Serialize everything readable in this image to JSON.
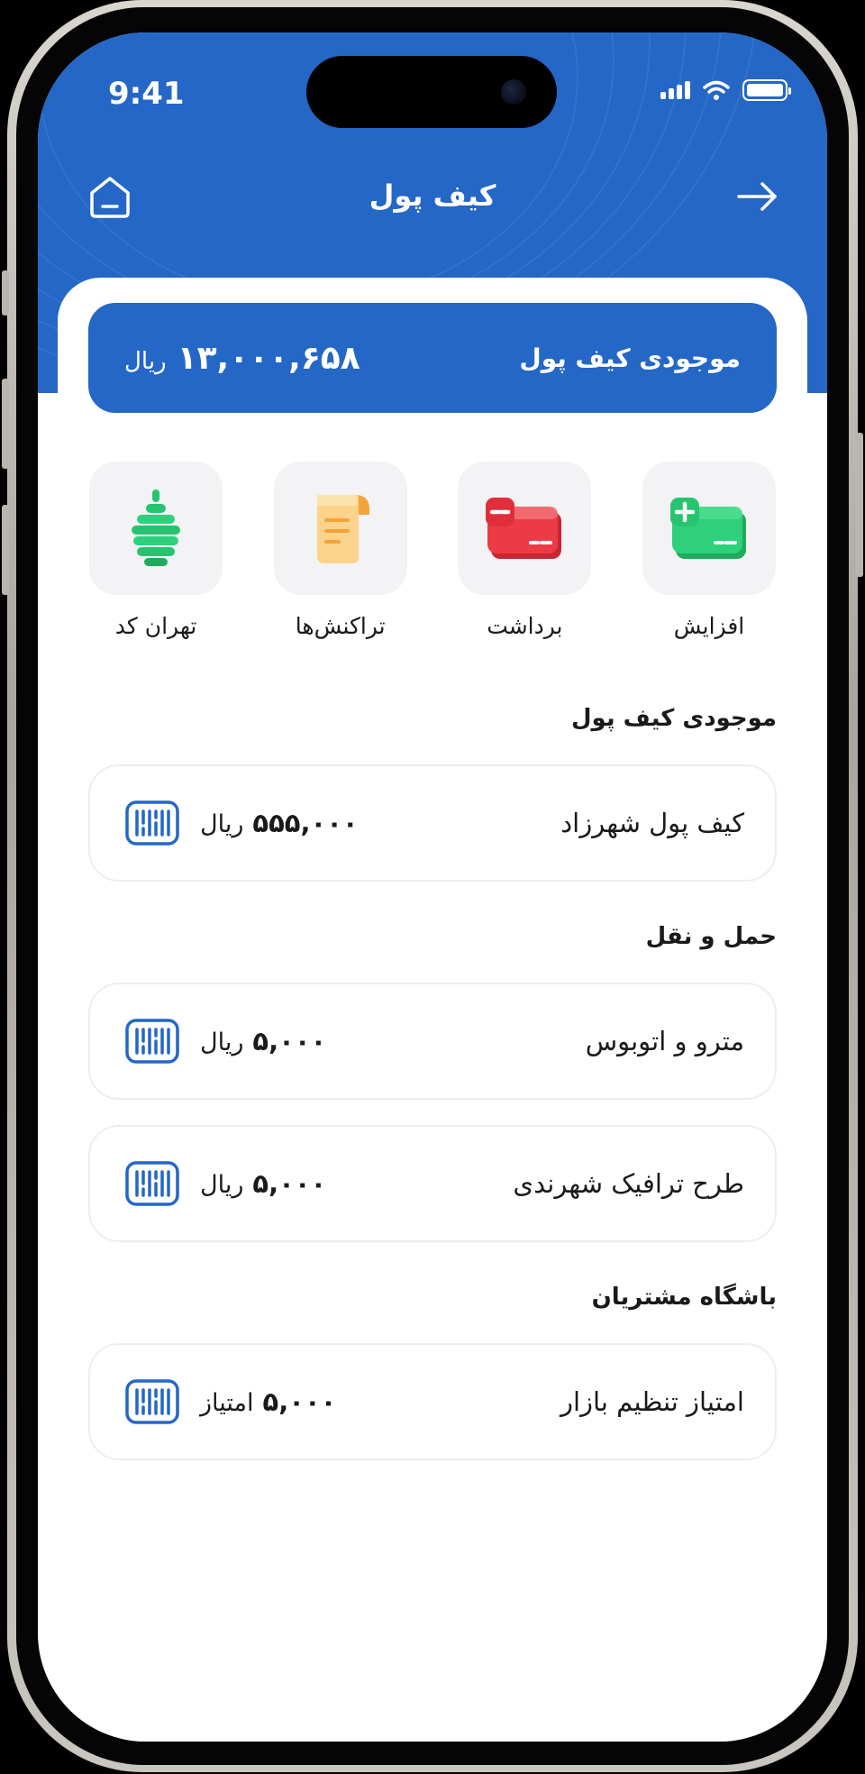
{
  "status_bar": {
    "time": "9:41"
  },
  "header": {
    "title": "کیف پول"
  },
  "balance": {
    "label": "موجودی کیف پول",
    "amount": "۱۳,۰۰۰,۶۵۸",
    "unit": "ریال"
  },
  "actions": [
    {
      "label": "افزایش",
      "icon": "wallet-add-icon"
    },
    {
      "label": "برداشت",
      "icon": "wallet-withdraw-icon"
    },
    {
      "label": "تراکنش‌ها",
      "icon": "receipt-icon"
    },
    {
      "label": "تهران کد",
      "icon": "tehran-code-icon"
    }
  ],
  "sections": [
    {
      "title": "موجودی کیف پول",
      "rows": [
        {
          "label": "کیف پول شهرزاد",
          "amount": "۵۵۵,۰۰۰",
          "unit": "ریال"
        }
      ]
    },
    {
      "title": "حمل و نقل",
      "rows": [
        {
          "label": "مترو و اتوبوس",
          "amount": "۵,۰۰۰",
          "unit": "ریال"
        },
        {
          "label": "طرح ترافیک شهرندی",
          "amount": "۵,۰۰۰",
          "unit": "ریال"
        }
      ]
    },
    {
      "title": "باشگاه مشتریان",
      "rows": [
        {
          "label": "امتیاز تنظیم بازار",
          "amount": "۵,۰۰۰",
          "unit": "امتیاز"
        }
      ]
    }
  ],
  "colors": {
    "primary": "#2467c6",
    "tile_bg": "#f3f3f5",
    "green": "#27c46f",
    "red": "#e8343f",
    "yellow": "#f7c75a"
  }
}
